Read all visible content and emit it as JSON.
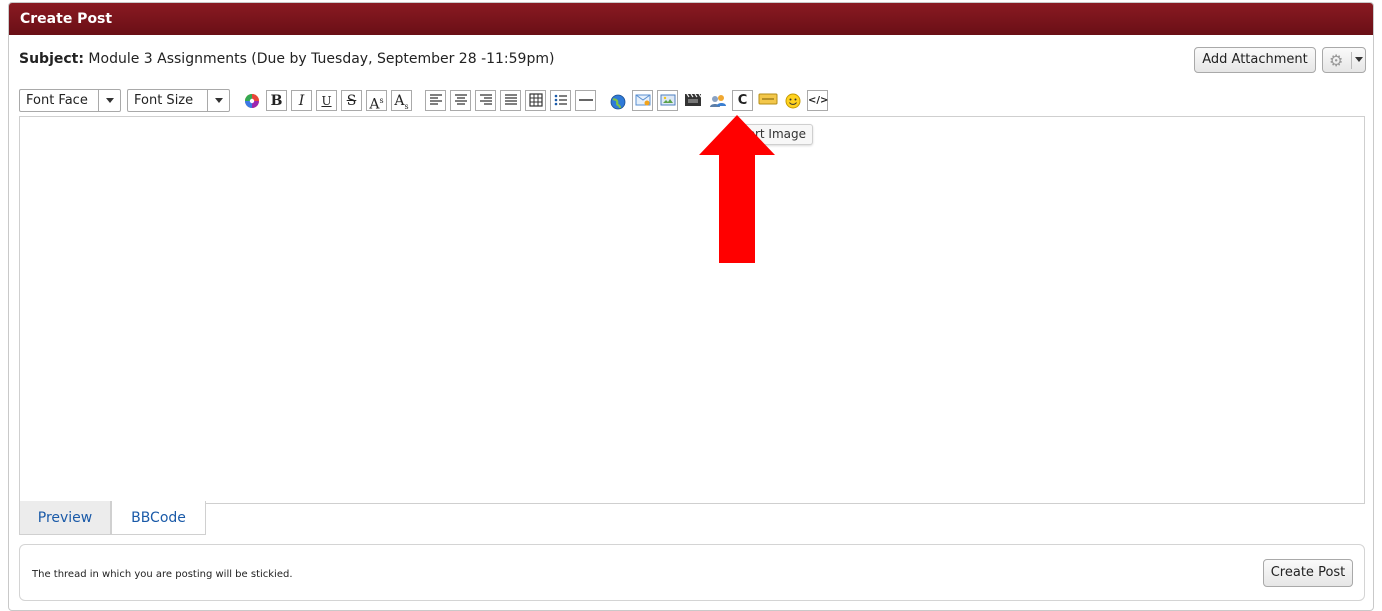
{
  "window": {
    "title": "Create Post"
  },
  "subject": {
    "label": "Subject:",
    "value": "Module 3 Assignments (Due by Tuesday, September 28 -11:59pm)"
  },
  "header_buttons": {
    "add_attachment": "Add Attachment"
  },
  "toolbar": {
    "font_face": "Font Face",
    "font_size": "Font Size",
    "bold": "B",
    "italic": "I",
    "underline": "U",
    "strike": "S",
    "superscript": "A",
    "superscript_mark": "s",
    "subscript": "A",
    "subscript_mark": "s",
    "code": "</>"
  },
  "tooltip": {
    "text": "ert Image"
  },
  "tabs": {
    "preview": "Preview",
    "bbcode": "BBCode",
    "active": "BBCode"
  },
  "footer": {
    "notice": "The thread in which you are posting will be stickied.",
    "submit": "Create Post"
  },
  "colors": {
    "title_bar": "#7a1419",
    "link": "#1a5aa8",
    "annotation_arrow": "#ff0000"
  }
}
